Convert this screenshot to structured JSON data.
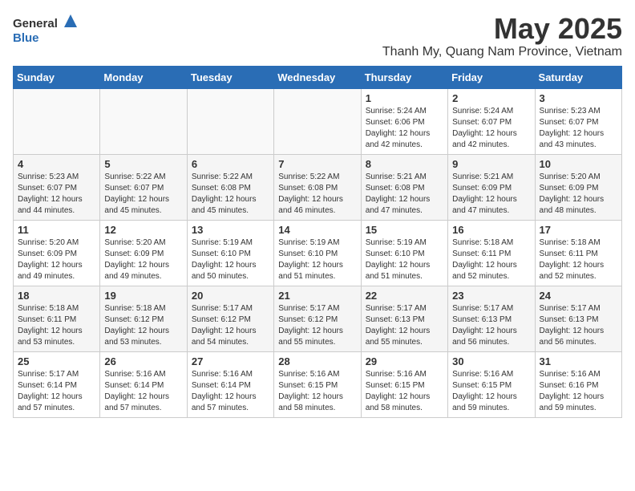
{
  "logo": {
    "general": "General",
    "blue": "Blue"
  },
  "header": {
    "month": "May 2025",
    "location": "Thanh My, Quang Nam Province, Vietnam"
  },
  "weekdays": [
    "Sunday",
    "Monday",
    "Tuesday",
    "Wednesday",
    "Thursday",
    "Friday",
    "Saturday"
  ],
  "weeks": [
    [
      {
        "day": "",
        "info": ""
      },
      {
        "day": "",
        "info": ""
      },
      {
        "day": "",
        "info": ""
      },
      {
        "day": "",
        "info": ""
      },
      {
        "day": "1",
        "info": "Sunrise: 5:24 AM\nSunset: 6:06 PM\nDaylight: 12 hours\nand 42 minutes."
      },
      {
        "day": "2",
        "info": "Sunrise: 5:24 AM\nSunset: 6:07 PM\nDaylight: 12 hours\nand 42 minutes."
      },
      {
        "day": "3",
        "info": "Sunrise: 5:23 AM\nSunset: 6:07 PM\nDaylight: 12 hours\nand 43 minutes."
      }
    ],
    [
      {
        "day": "4",
        "info": "Sunrise: 5:23 AM\nSunset: 6:07 PM\nDaylight: 12 hours\nand 44 minutes."
      },
      {
        "day": "5",
        "info": "Sunrise: 5:22 AM\nSunset: 6:07 PM\nDaylight: 12 hours\nand 45 minutes."
      },
      {
        "day": "6",
        "info": "Sunrise: 5:22 AM\nSunset: 6:08 PM\nDaylight: 12 hours\nand 45 minutes."
      },
      {
        "day": "7",
        "info": "Sunrise: 5:22 AM\nSunset: 6:08 PM\nDaylight: 12 hours\nand 46 minutes."
      },
      {
        "day": "8",
        "info": "Sunrise: 5:21 AM\nSunset: 6:08 PM\nDaylight: 12 hours\nand 47 minutes."
      },
      {
        "day": "9",
        "info": "Sunrise: 5:21 AM\nSunset: 6:09 PM\nDaylight: 12 hours\nand 47 minutes."
      },
      {
        "day": "10",
        "info": "Sunrise: 5:20 AM\nSunset: 6:09 PM\nDaylight: 12 hours\nand 48 minutes."
      }
    ],
    [
      {
        "day": "11",
        "info": "Sunrise: 5:20 AM\nSunset: 6:09 PM\nDaylight: 12 hours\nand 49 minutes."
      },
      {
        "day": "12",
        "info": "Sunrise: 5:20 AM\nSunset: 6:09 PM\nDaylight: 12 hours\nand 49 minutes."
      },
      {
        "day": "13",
        "info": "Sunrise: 5:19 AM\nSunset: 6:10 PM\nDaylight: 12 hours\nand 50 minutes."
      },
      {
        "day": "14",
        "info": "Sunrise: 5:19 AM\nSunset: 6:10 PM\nDaylight: 12 hours\nand 51 minutes."
      },
      {
        "day": "15",
        "info": "Sunrise: 5:19 AM\nSunset: 6:10 PM\nDaylight: 12 hours\nand 51 minutes."
      },
      {
        "day": "16",
        "info": "Sunrise: 5:18 AM\nSunset: 6:11 PM\nDaylight: 12 hours\nand 52 minutes."
      },
      {
        "day": "17",
        "info": "Sunrise: 5:18 AM\nSunset: 6:11 PM\nDaylight: 12 hours\nand 52 minutes."
      }
    ],
    [
      {
        "day": "18",
        "info": "Sunrise: 5:18 AM\nSunset: 6:11 PM\nDaylight: 12 hours\nand 53 minutes."
      },
      {
        "day": "19",
        "info": "Sunrise: 5:18 AM\nSunset: 6:12 PM\nDaylight: 12 hours\nand 53 minutes."
      },
      {
        "day": "20",
        "info": "Sunrise: 5:17 AM\nSunset: 6:12 PM\nDaylight: 12 hours\nand 54 minutes."
      },
      {
        "day": "21",
        "info": "Sunrise: 5:17 AM\nSunset: 6:12 PM\nDaylight: 12 hours\nand 55 minutes."
      },
      {
        "day": "22",
        "info": "Sunrise: 5:17 AM\nSunset: 6:13 PM\nDaylight: 12 hours\nand 55 minutes."
      },
      {
        "day": "23",
        "info": "Sunrise: 5:17 AM\nSunset: 6:13 PM\nDaylight: 12 hours\nand 56 minutes."
      },
      {
        "day": "24",
        "info": "Sunrise: 5:17 AM\nSunset: 6:13 PM\nDaylight: 12 hours\nand 56 minutes."
      }
    ],
    [
      {
        "day": "25",
        "info": "Sunrise: 5:17 AM\nSunset: 6:14 PM\nDaylight: 12 hours\nand 57 minutes."
      },
      {
        "day": "26",
        "info": "Sunrise: 5:16 AM\nSunset: 6:14 PM\nDaylight: 12 hours\nand 57 minutes."
      },
      {
        "day": "27",
        "info": "Sunrise: 5:16 AM\nSunset: 6:14 PM\nDaylight: 12 hours\nand 57 minutes."
      },
      {
        "day": "28",
        "info": "Sunrise: 5:16 AM\nSunset: 6:15 PM\nDaylight: 12 hours\nand 58 minutes."
      },
      {
        "day": "29",
        "info": "Sunrise: 5:16 AM\nSunset: 6:15 PM\nDaylight: 12 hours\nand 58 minutes."
      },
      {
        "day": "30",
        "info": "Sunrise: 5:16 AM\nSunset: 6:15 PM\nDaylight: 12 hours\nand 59 minutes."
      },
      {
        "day": "31",
        "info": "Sunrise: 5:16 AM\nSunset: 6:16 PM\nDaylight: 12 hours\nand 59 minutes."
      }
    ]
  ]
}
